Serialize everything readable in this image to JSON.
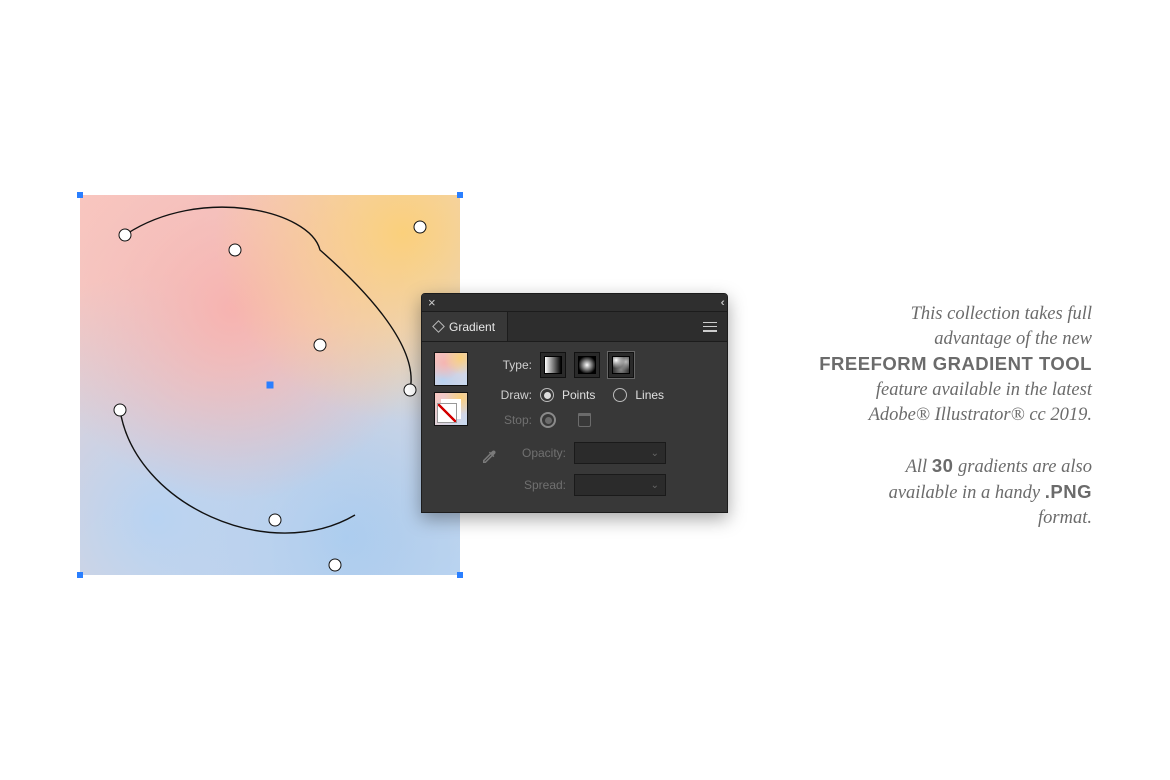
{
  "panel": {
    "title": "Gradient",
    "rows": {
      "type": "Type:",
      "draw": "Draw:",
      "stop": "Stop:",
      "opacity": "Opacity:",
      "spread": "Spread:"
    },
    "draw_options": {
      "points": "Points",
      "lines": "Lines"
    },
    "draw_selected": "points",
    "type_selected": "freeform"
  },
  "copy": {
    "p1_line1": "This collection takes full",
    "p1_line2": "advantage of the new",
    "p1_bold": "FREEFORM GRADIENT TOOL",
    "p1_line3": "feature available in the latest",
    "p1_line4": "Adobe® Illustrator® cc 2019.",
    "p2_line1_pre": "All ",
    "p2_line1_bold": "30",
    "p2_line1_post": " gradients are also",
    "p2_line2_pre": "available in a handy ",
    "p2_line2_bold": ".PNG",
    "p2_line3": "format."
  }
}
